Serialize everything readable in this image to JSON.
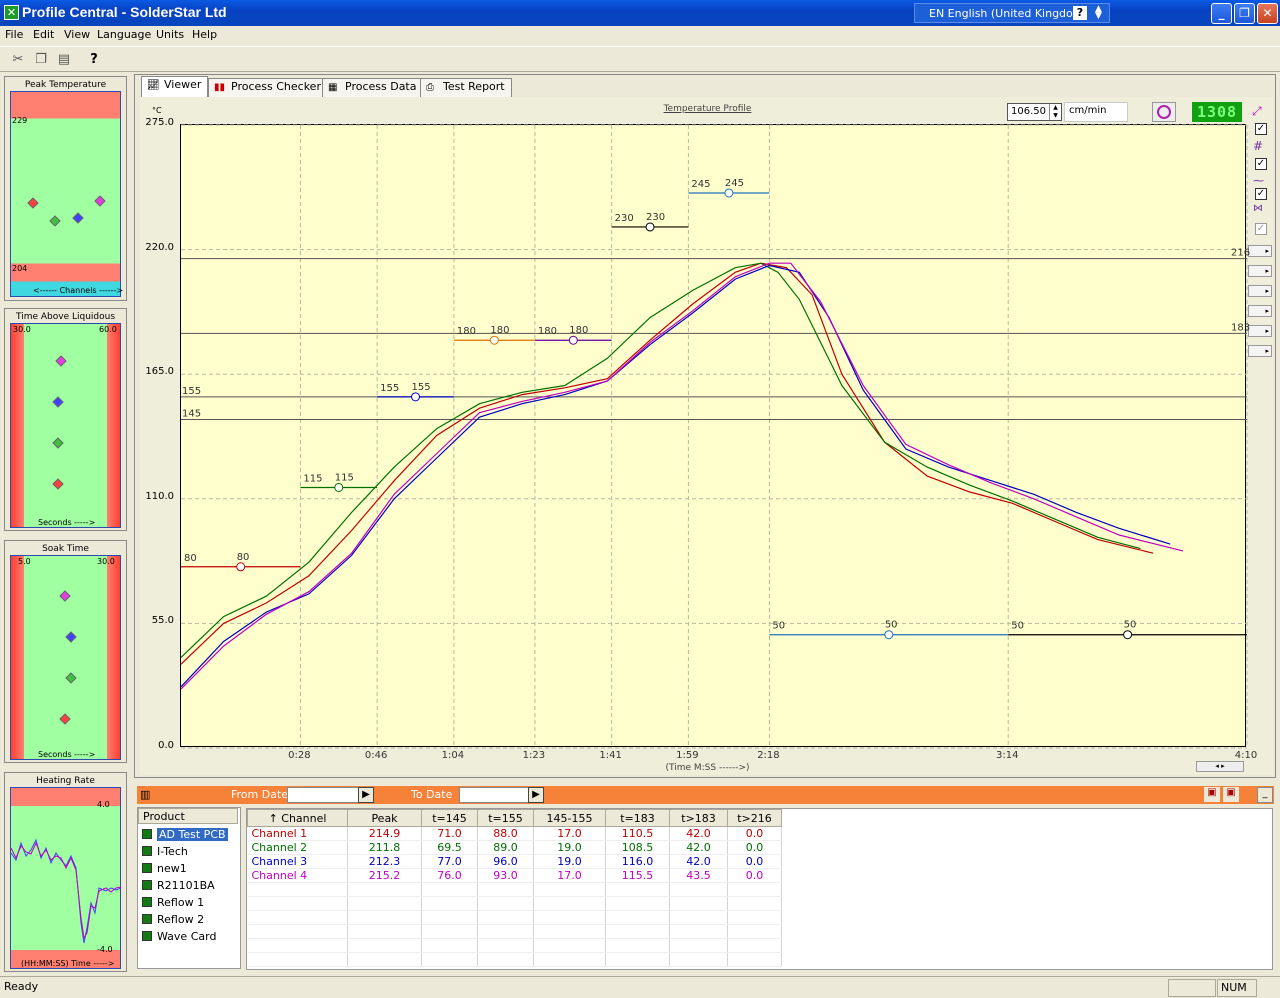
{
  "window": {
    "title": "Profile Central - SolderStar Ltd",
    "language": "EN English (United Kingdom)",
    "help": "?"
  },
  "menu": [
    "File",
    "Edit",
    "View",
    "Language",
    "Units",
    "Help"
  ],
  "left_panels": {
    "peak": {
      "title": "Peak Temperature",
      "top": "229",
      "bottom": "204",
      "axis": "Channels"
    },
    "tal": {
      "title": "Time Above Liquidous",
      "left": "30.0",
      "right": "60.0",
      "axis": "Seconds"
    },
    "soak": {
      "title": "Soak Time",
      "left": "5.0",
      "right": "30.0",
      "axis": "Seconds"
    },
    "rate": {
      "title": "Heating Rate",
      "top": "4.0",
      "bottom": "-4.0",
      "axis": "(HH:MM:SS) Time"
    }
  },
  "tabs": [
    {
      "label": "Viewer",
      "icon": "chart-icon"
    },
    {
      "label": "Process Checker",
      "icon": "bar-chart-icon"
    },
    {
      "label": "Process Data",
      "icon": "grid-icon"
    },
    {
      "label": "Test Report",
      "icon": "printer-icon"
    }
  ],
  "controls": {
    "speed": "106.50",
    "speed_unit": "cm/min",
    "lcd": "1308"
  },
  "colors": {
    "ch1": "#c00000",
    "ch2": "#007000",
    "ch3": "#0000c0",
    "ch4": "#c000c0",
    "plot_bg": "#ffffce"
  },
  "chart_data": {
    "type": "line",
    "title": "Temperature Profile",
    "ylabel": "°C",
    "xlabel": "(Time M:SS ------>)",
    "ylim": [
      0,
      275
    ],
    "xlim": [
      0,
      250
    ],
    "y_ticks": [
      "275.0",
      "220.0",
      "165.0",
      "110.0",
      "55.0",
      "0.0"
    ],
    "x_ticks": [
      {
        "t": 28,
        "label": "0:28"
      },
      {
        "t": 46,
        "label": "0:46"
      },
      {
        "t": 64,
        "label": "1:04"
      },
      {
        "t": 83,
        "label": "1:23"
      },
      {
        "t": 101,
        "label": "1:41"
      },
      {
        "t": 119,
        "label": "1:59"
      },
      {
        "t": 138,
        "label": "2:18"
      },
      {
        "t": 194,
        "label": "3:14"
      },
      {
        "t": 250,
        "label": "4:10"
      }
    ],
    "h_lines": [
      {
        "y": 216,
        "label": "216"
      },
      {
        "y": 183,
        "label": "183"
      },
      {
        "y": 155,
        "label": "155"
      },
      {
        "y": 145,
        "label": "145"
      }
    ],
    "setpoints": [
      {
        "x0": 0,
        "x1": 28,
        "y": 80,
        "label": "80",
        "value": "80",
        "color": "#c00000"
      },
      {
        "x0": 28,
        "x1": 46,
        "y": 115,
        "label": "115",
        "value": "115",
        "color": "#007000"
      },
      {
        "x0": 46,
        "x1": 64,
        "y": 155,
        "label": "155",
        "value": "155",
        "color": "#0000c0"
      },
      {
        "x0": 64,
        "x1": 83,
        "y": 180,
        "label": "180",
        "value": "180",
        "color": "#e07000"
      },
      {
        "x0": 83,
        "x1": 101,
        "y": 180,
        "label": "180",
        "value": "180",
        "color": "#6000a0"
      },
      {
        "x0": 101,
        "x1": 119,
        "y": 230,
        "label": "230",
        "value": "230",
        "color": "#000000"
      },
      {
        "x0": 119,
        "x1": 138,
        "y": 245,
        "label": "245",
        "value": "245",
        "color": "#2070c0"
      },
      {
        "x0": 138,
        "x1": 194,
        "y": 50,
        "label": "50",
        "value": "50",
        "color": "#2070c0"
      },
      {
        "x0": 194,
        "x1": 250,
        "y": 50,
        "label": "50",
        "value": "50",
        "color": "#000000"
      }
    ],
    "series": [
      {
        "name": "Channel 1",
        "color": "#c00000",
        "points": [
          [
            0,
            37
          ],
          [
            10,
            55
          ],
          [
            20,
            64
          ],
          [
            30,
            76
          ],
          [
            40,
            96
          ],
          [
            50,
            118
          ],
          [
            60,
            138
          ],
          [
            70,
            150
          ],
          [
            80,
            156
          ],
          [
            90,
            159
          ],
          [
            100,
            163
          ],
          [
            110,
            180
          ],
          [
            120,
            196
          ],
          [
            130,
            210
          ],
          [
            136,
            214
          ],
          [
            142,
            212
          ],
          [
            148,
            200
          ],
          [
            155,
            165
          ],
          [
            165,
            135
          ],
          [
            175,
            120
          ],
          [
            185,
            113
          ],
          [
            195,
            108
          ],
          [
            205,
            100
          ],
          [
            215,
            92
          ],
          [
            228,
            86
          ]
        ]
      },
      {
        "name": "Channel 2",
        "color": "#007000",
        "points": [
          [
            0,
            40
          ],
          [
            10,
            58
          ],
          [
            20,
            67
          ],
          [
            30,
            82
          ],
          [
            40,
            104
          ],
          [
            50,
            124
          ],
          [
            60,
            141
          ],
          [
            70,
            152
          ],
          [
            80,
            157
          ],
          [
            90,
            160
          ],
          [
            100,
            172
          ],
          [
            110,
            190
          ],
          [
            120,
            202
          ],
          [
            130,
            212
          ],
          [
            136,
            214
          ],
          [
            140,
            210
          ],
          [
            145,
            198
          ],
          [
            155,
            160
          ],
          [
            165,
            135
          ],
          [
            175,
            124
          ],
          [
            185,
            116
          ],
          [
            195,
            109
          ],
          [
            205,
            101
          ],
          [
            215,
            93
          ],
          [
            225,
            88
          ]
        ]
      },
      {
        "name": "Channel 3",
        "color": "#0000c0",
        "points": [
          [
            0,
            27
          ],
          [
            10,
            47
          ],
          [
            20,
            60
          ],
          [
            30,
            68
          ],
          [
            40,
            85
          ],
          [
            50,
            110
          ],
          [
            60,
            128
          ],
          [
            70,
            146
          ],
          [
            80,
            152
          ],
          [
            90,
            156
          ],
          [
            100,
            162
          ],
          [
            110,
            178
          ],
          [
            120,
            192
          ],
          [
            130,
            207
          ],
          [
            138,
            213
          ],
          [
            145,
            210
          ],
          [
            152,
            190
          ],
          [
            160,
            158
          ],
          [
            170,
            132
          ],
          [
            180,
            124
          ],
          [
            190,
            118
          ],
          [
            200,
            112
          ],
          [
            210,
            104
          ],
          [
            220,
            97
          ],
          [
            232,
            90
          ]
        ]
      },
      {
        "name": "Channel 4",
        "color": "#c000c0",
        "points": [
          [
            0,
            26
          ],
          [
            10,
            45
          ],
          [
            20,
            59
          ],
          [
            30,
            69
          ],
          [
            40,
            86
          ],
          [
            50,
            112
          ],
          [
            60,
            130
          ],
          [
            70,
            148
          ],
          [
            80,
            153
          ],
          [
            90,
            157
          ],
          [
            100,
            162
          ],
          [
            110,
            179
          ],
          [
            120,
            193
          ],
          [
            130,
            208
          ],
          [
            138,
            214
          ],
          [
            143,
            214
          ],
          [
            150,
            197
          ],
          [
            160,
            160
          ],
          [
            170,
            134
          ],
          [
            180,
            125
          ],
          [
            190,
            117
          ],
          [
            200,
            110
          ],
          [
            210,
            102
          ],
          [
            220,
            94
          ],
          [
            235,
            87
          ]
        ]
      }
    ]
  },
  "bottom": {
    "from": "From Date",
    "to": "To Date"
  },
  "products": {
    "header": "Product",
    "items": [
      "AD Test PCB",
      "I-Tech",
      "new1",
      "R21101BA",
      "Reflow 1",
      "Reflow 2",
      "Wave Card"
    ]
  },
  "table": {
    "headers": [
      "Channel",
      "Peak",
      "t=145",
      "t=155",
      "145-155",
      "t=183",
      "t>183",
      "t>216"
    ],
    "rows": [
      [
        "Channel 1",
        "214.9",
        "71.0",
        "88.0",
        "17.0",
        "110.5",
        "42.0",
        "0.0"
      ],
      [
        "Channel 2",
        "211.8",
        "69.5",
        "89.0",
        "19.0",
        "108.5",
        "42.0",
        "0.0"
      ],
      [
        "Channel 3",
        "212.3",
        "77.0",
        "96.0",
        "19.0",
        "116.0",
        "42.0",
        "0.0"
      ],
      [
        "Channel 4",
        "215.2",
        "76.0",
        "93.0",
        "17.0",
        "115.5",
        "43.5",
        "0.0"
      ]
    ]
  },
  "status": {
    "text": "Ready",
    "num": "NUM"
  }
}
